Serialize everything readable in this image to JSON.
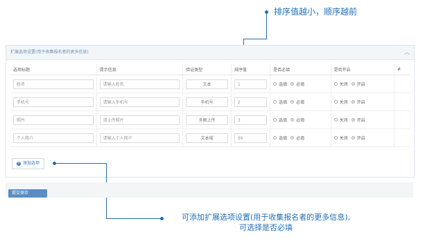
{
  "annotations": {
    "top": "排序值越小，顺序越前",
    "bottom_line1": "可添加扩展选项设置(用于收集报名者的更多信息),",
    "bottom_line2": "可选择是否必填"
  },
  "panel": {
    "title": "扩展选项设置(用于收集报名者的更多信息)",
    "collapse_icon": "chevron-up-icon"
  },
  "table": {
    "headers": [
      "选项标题",
      "提示信息",
      "验证类型",
      "排序值",
      "是否必填",
      "是否开启",
      "#"
    ],
    "radio_labels": {
      "optional": "选填",
      "required": "必填",
      "off": "关闭",
      "on": "开启"
    },
    "rows": [
      {
        "title": "姓名",
        "hint": "请输入姓名",
        "validation": "文本",
        "sort": "1",
        "required": true,
        "enabled": true
      },
      {
        "title": "手机号",
        "hint": "请输入手机号",
        "validation": "手机号",
        "sort": "2",
        "required": true,
        "enabled": true
      },
      {
        "title": "照片",
        "hint": "请上传照片",
        "validation": "多图上传",
        "sort": "3",
        "required": true,
        "enabled": true
      },
      {
        "title": "个人简介",
        "hint": "请输入个人简介",
        "validation": "文本域",
        "sort": "99",
        "required": true,
        "enabled": true
      }
    ]
  },
  "add_button": {
    "label": "添加选项"
  },
  "submit_button": {
    "label": "提交保存"
  },
  "colors": {
    "accent": "#1e6fb8",
    "button_blue": "#5b8dc4"
  }
}
